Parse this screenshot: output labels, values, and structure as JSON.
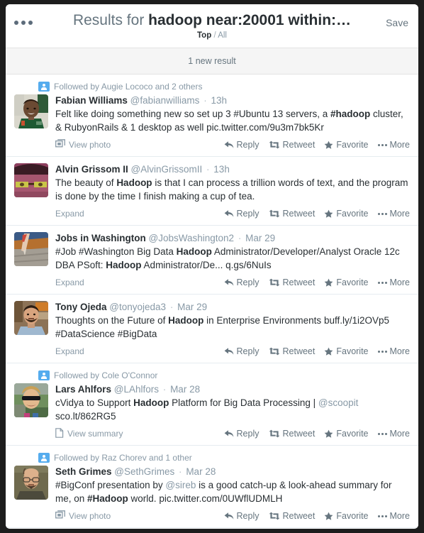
{
  "header": {
    "menu_icon": "ellipsis-icon",
    "title_prefix": "Results for ",
    "title_query": "hadoop near:20001 within:…",
    "save_label": "Save",
    "subnav": {
      "current": "Top",
      "separator": "/",
      "other": "All"
    }
  },
  "new_results_bar": {
    "label": "1 new result"
  },
  "actions": {
    "reply": "Reply",
    "retweet": "Retweet",
    "favorite": "Favorite",
    "more": "More"
  },
  "tweets": [
    {
      "context": "Followed by Augie Lococo and 2 others",
      "fullname": "Fabian Williams",
      "handle": "@fabianwilliams",
      "time": "13h",
      "text_parts": [
        {
          "t": "Felt like doing something new so set up 3 ",
          "s": "plain"
        },
        {
          "t": "#Ubuntu",
          "s": "hash"
        },
        {
          "t": " 13 servers, a ",
          "s": "plain"
        },
        {
          "t": "#hadoop",
          "s": "bold"
        },
        {
          "t": " cluster, & RubyonRails & 1 desktop as well ",
          "s": "plain"
        },
        {
          "t": "pic.twitter.com/9u3m7bk5Kr",
          "s": "link"
        }
      ],
      "expand_label": "View photo",
      "expand_icon": "photo-icon"
    },
    {
      "context": null,
      "fullname": "Alvin Grissom II",
      "handle": "@AlvinGrissomII",
      "time": "13h",
      "text_parts": [
        {
          "t": "The beauty of ",
          "s": "plain"
        },
        {
          "t": "Hadoop",
          "s": "bold"
        },
        {
          "t": " is that I  can process a trillion words of text, and the program is done by the time I finish making a cup of tea.",
          "s": "plain"
        }
      ],
      "expand_label": "Expand",
      "expand_icon": null
    },
    {
      "context": null,
      "fullname": "Jobs in Washington",
      "handle": "@JobsWashington2",
      "time": "Mar 29",
      "text_parts": [
        {
          "t": "#Job #Washington",
          "s": "hash"
        },
        {
          "t": " Big Data ",
          "s": "plain"
        },
        {
          "t": "Hadoop",
          "s": "bold"
        },
        {
          "t": " Administrator/Developer/Analyst Oracle 12c DBA PSoft: ",
          "s": "plain"
        },
        {
          "t": "Hadoop",
          "s": "bold"
        },
        {
          "t": " Administrator/De... ",
          "s": "plain"
        },
        {
          "t": "q.gs/6NuIs",
          "s": "link"
        }
      ],
      "expand_label": "Expand",
      "expand_icon": null
    },
    {
      "context": null,
      "fullname": "Tony Ojeda",
      "handle": "@tonyojeda3",
      "time": "Mar 29",
      "text_parts": [
        {
          "t": "Thoughts on the Future of ",
          "s": "plain"
        },
        {
          "t": "Hadoop",
          "s": "bold"
        },
        {
          "t": " in Enterprise Environments ",
          "s": "plain"
        },
        {
          "t": "buff.ly/1i2OVp5",
          "s": "link"
        },
        {
          "t": " ",
          "s": "plain"
        },
        {
          "t": "#DataScience #BigData",
          "s": "hash"
        }
      ],
      "expand_label": "Expand",
      "expand_icon": null
    },
    {
      "context": "Followed by Cole O'Connor",
      "fullname": "Lars Ahlfors",
      "handle": "@LAhlfors",
      "time": "Mar 28",
      "text_parts": [
        {
          "t": "cVidya to Support ",
          "s": "plain"
        },
        {
          "t": "Hadoop",
          "s": "bold"
        },
        {
          "t": " Platform for Big Data Processing | ",
          "s": "plain"
        },
        {
          "t": "@scoopit",
          "s": "mention"
        },
        {
          "t": " ",
          "s": "plain"
        },
        {
          "t": "sco.lt/862RG5",
          "s": "link"
        }
      ],
      "expand_label": "View summary",
      "expand_icon": "summary-icon"
    },
    {
      "context": "Followed by Raz Chorev and 1 other",
      "fullname": "Seth Grimes",
      "handle": "@SethGrimes",
      "time": "Mar 28",
      "text_parts": [
        {
          "t": "#BigConf",
          "s": "hash"
        },
        {
          "t": " presentation by ",
          "s": "plain"
        },
        {
          "t": "@sireb",
          "s": "mention"
        },
        {
          "t": " is a good catch-up & look-ahead summary for me, on ",
          "s": "plain"
        },
        {
          "t": "#Hadoop",
          "s": "bold"
        },
        {
          "t": " world. ",
          "s": "plain"
        },
        {
          "t": "pic.twitter.com/0UWflUDMLH",
          "s": "link"
        }
      ],
      "expand_label": "View photo",
      "expand_icon": "photo-icon"
    }
  ],
  "colors": {
    "accent_blue": "#55acee",
    "text_dark": "#292f33",
    "text_gray": "#8899a6",
    "frame": "#1d1d1d"
  }
}
